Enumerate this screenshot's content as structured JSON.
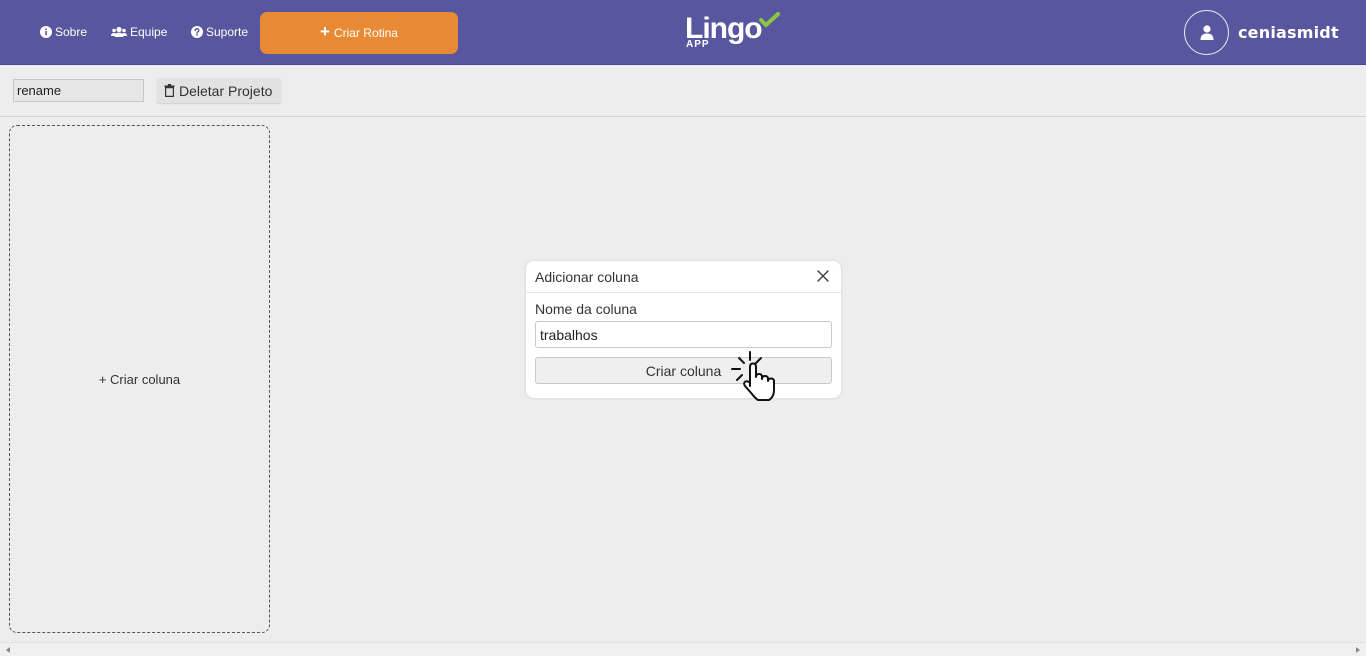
{
  "nav": {
    "links": [
      {
        "label": "Sobre",
        "icon": "info-circle-icon"
      },
      {
        "label": "Equipe",
        "icon": "users-icon"
      },
      {
        "label": "Suporte",
        "icon": "question-circle-icon"
      }
    ],
    "criar_rotina_label": "Criar Rotina",
    "logo_text": "Lingo",
    "logo_sub": "APP",
    "username": "ceniasmidt"
  },
  "toolbar": {
    "rename_value": "rename",
    "delete_label": "Deletar Projeto"
  },
  "board": {
    "add_column_label": "+ Criar coluna"
  },
  "modal": {
    "title": "Adicionar coluna",
    "field_label": "Nome da coluna",
    "input_value": "trabalhos",
    "submit_label": "Criar coluna"
  },
  "colors": {
    "header_bg": "#58569e",
    "accent_orange": "#e88a33",
    "logo_check": "#8cc63f",
    "page_bg": "#ededed"
  }
}
